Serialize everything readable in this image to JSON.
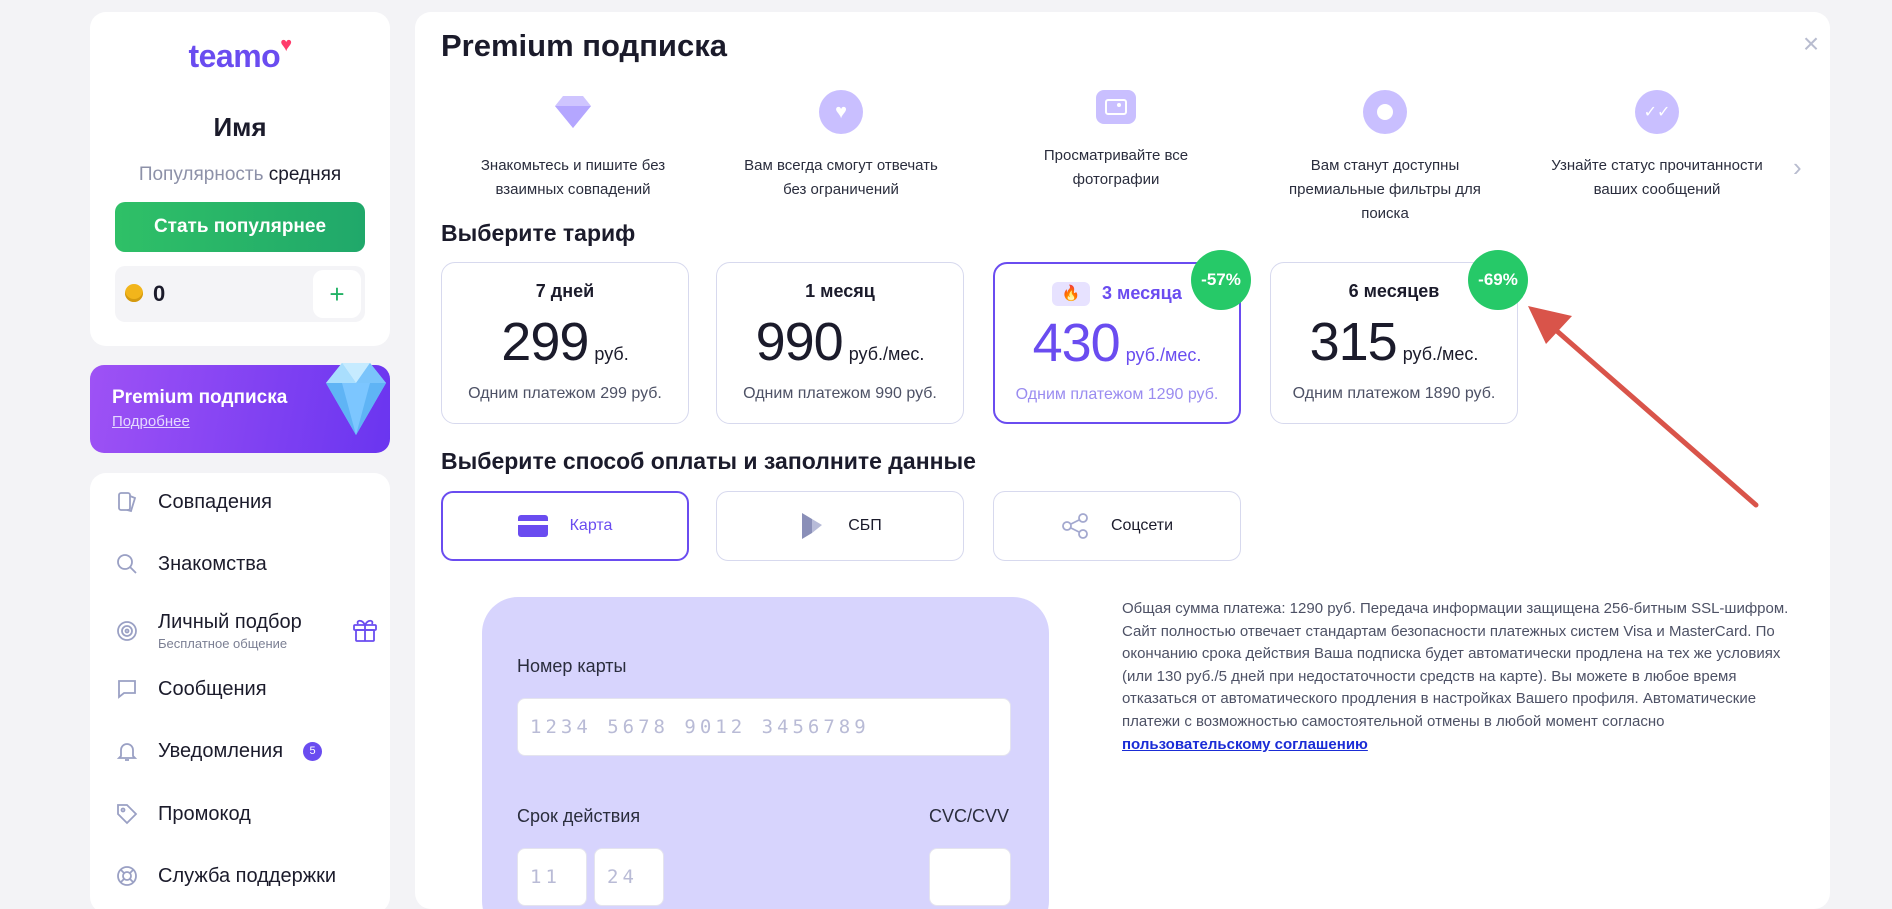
{
  "sidebar": {
    "logo": "teamo",
    "user_name": "Имя",
    "popularity_label": "Популярность",
    "popularity_value": "средняя",
    "boost_button": "Стать популярнее",
    "coins": "0",
    "add_coins": "+",
    "premium": {
      "title": "Premium подписка",
      "link": "Подробнее"
    },
    "nav": [
      {
        "label": "Совпадения",
        "icon": "matches-icon"
      },
      {
        "label": "Знакомства",
        "icon": "search-icon"
      },
      {
        "label": "Личный подбор",
        "sub": "Бесплатное общение",
        "icon": "target-icon"
      },
      {
        "label": "Сообщения",
        "icon": "chat-icon"
      },
      {
        "label": "Уведомления",
        "badge": "5",
        "icon": "bell-icon"
      },
      {
        "label": "Промокод",
        "icon": "tag-icon"
      },
      {
        "label": "Служба поддержки",
        "icon": "lifebuoy-icon"
      }
    ]
  },
  "main": {
    "title": "Premium подписка",
    "close": "×",
    "features": [
      {
        "text": "Знакомьтесь и пишите без взаимных совпадений",
        "icon": "diamond-icon"
      },
      {
        "text": "Вам всегда смогут отвечать без ограничений",
        "icon": "heart-chat-icon"
      },
      {
        "text": "Просматривайте все фотографии",
        "icon": "photo-icon"
      },
      {
        "text": "Вам станут доступны премиальные фильтры для поиска",
        "icon": "filter-icon"
      },
      {
        "text": "Узнайте статус прочитанности ваших сообщений",
        "icon": "read-check-icon"
      }
    ],
    "features_next": "›",
    "tariff_heading": "Выберите тариф",
    "tariffs": [
      {
        "name": "7 дней",
        "price": "299",
        "unit": "руб.",
        "once": "Одним платежом 299 руб.",
        "selected": false
      },
      {
        "name": "1 месяц",
        "price": "990",
        "unit": "руб./мес.",
        "once": "Одним платежом 990 руб.",
        "selected": false
      },
      {
        "name": "3 месяца",
        "price": "430",
        "unit": "руб./мес.",
        "once": "Одним платежом 1290 руб.",
        "selected": true,
        "discount": "-57%",
        "fire": "🔥"
      },
      {
        "name": "6 месяцев",
        "price": "315",
        "unit": "руб./мес.",
        "once": "Одним платежом 1890 руб.",
        "selected": false,
        "discount": "-69%"
      }
    ],
    "payment_heading": "Выберите способ оплаты и заполните данные",
    "payment_methods": [
      {
        "label": "Карта",
        "icon": "card-icon",
        "selected": true
      },
      {
        "label": "СБП",
        "icon": "sbp-icon",
        "selected": false
      },
      {
        "label": "Соцсети",
        "icon": "share-icon",
        "selected": false
      }
    ],
    "card_form": {
      "number_label": "Номер карты",
      "number_placeholder": "1234 5678 9012 3456789",
      "expiry_label": "Срок действия",
      "month_placeholder": "11",
      "year_placeholder": "24",
      "cvc_label": "CVC/CVV"
    },
    "info_text": "Общая сумма платежа: 1290 руб. Передача информации защищена 256-битным SSL-шифром. Сайт полностью отвечает стандартам безопасности платежных систем Visa и MasterCard. По окончанию срока действия Ваша подписка будет автоматически продлена на тех же условиях (или 130 руб./5 дней при недостаточности средств на карте). Вы можете в любое время отказаться от автоматического продления в настройках Вашего профиля. Автоматические платежи с возможностью самостоятельной отмены в любой момент согласно",
    "info_link": "пользовательскому соглашению"
  },
  "colors": {
    "accent": "#6a4cf0",
    "green": "#26c968",
    "arrow": "#d9544a"
  }
}
